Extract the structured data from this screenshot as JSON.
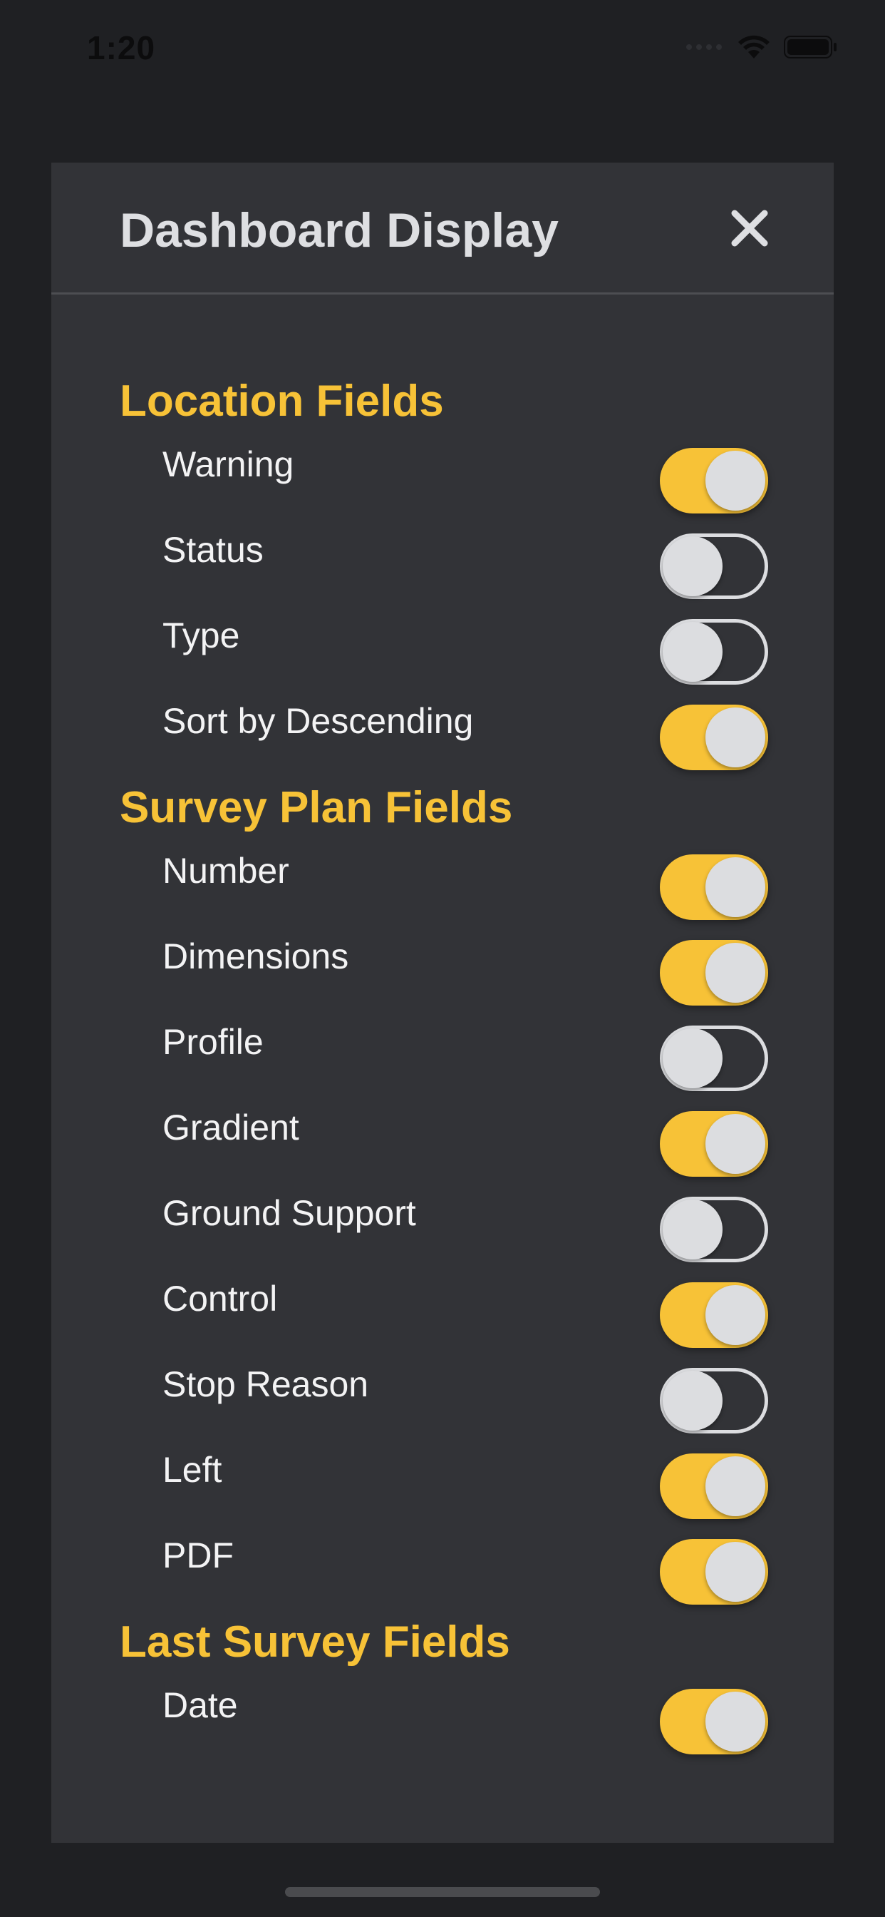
{
  "status_bar": {
    "time": "1:20"
  },
  "dialog": {
    "title": "Dashboard Display",
    "close_icon": "close-x-icon"
  },
  "colors": {
    "accent": "#f7c237",
    "panel": "#323337",
    "background": "#1f2023",
    "text": "#f3f3f4",
    "toggle_off_knob": "#dcdde0"
  },
  "sections": [
    {
      "title": "Location Fields",
      "rows": [
        {
          "label": "Warning",
          "on": true
        },
        {
          "label": "Status",
          "on": false
        },
        {
          "label": "Type",
          "on": false
        },
        {
          "label": "Sort by Descending",
          "on": true
        }
      ]
    },
    {
      "title": "Survey Plan Fields",
      "rows": [
        {
          "label": "Number",
          "on": true
        },
        {
          "label": "Dimensions",
          "on": true
        },
        {
          "label": "Profile",
          "on": false
        },
        {
          "label": "Gradient",
          "on": true
        },
        {
          "label": "Ground Support",
          "on": false
        },
        {
          "label": "Control",
          "on": true
        },
        {
          "label": "Stop Reason",
          "on": false
        },
        {
          "label": "Left",
          "on": true
        },
        {
          "label": "PDF",
          "on": true
        }
      ]
    },
    {
      "title": "Last Survey Fields",
      "rows": [
        {
          "label": "Date",
          "on": true
        }
      ]
    }
  ]
}
